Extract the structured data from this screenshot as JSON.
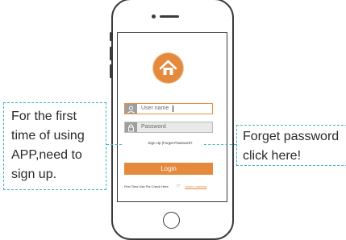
{
  "login_screen": {
    "username_placeholder": "User name",
    "password_placeholder": "Password",
    "links_text": "Sign Up |Forget Password?",
    "login_label": "Login",
    "first_time_text": "First Time Use Pls Check Here",
    "video_link": "Video Learning"
  },
  "callouts": {
    "left_lines": [
      "For the first",
      "time of using",
      "APP,need to",
      "sign up."
    ],
    "right_lines": [
      "Forget password",
      "click here!"
    ]
  },
  "colors": {
    "accent": "#e58a3c",
    "callout_border": "#3ab3c8",
    "frame": "#3b3b3b"
  }
}
